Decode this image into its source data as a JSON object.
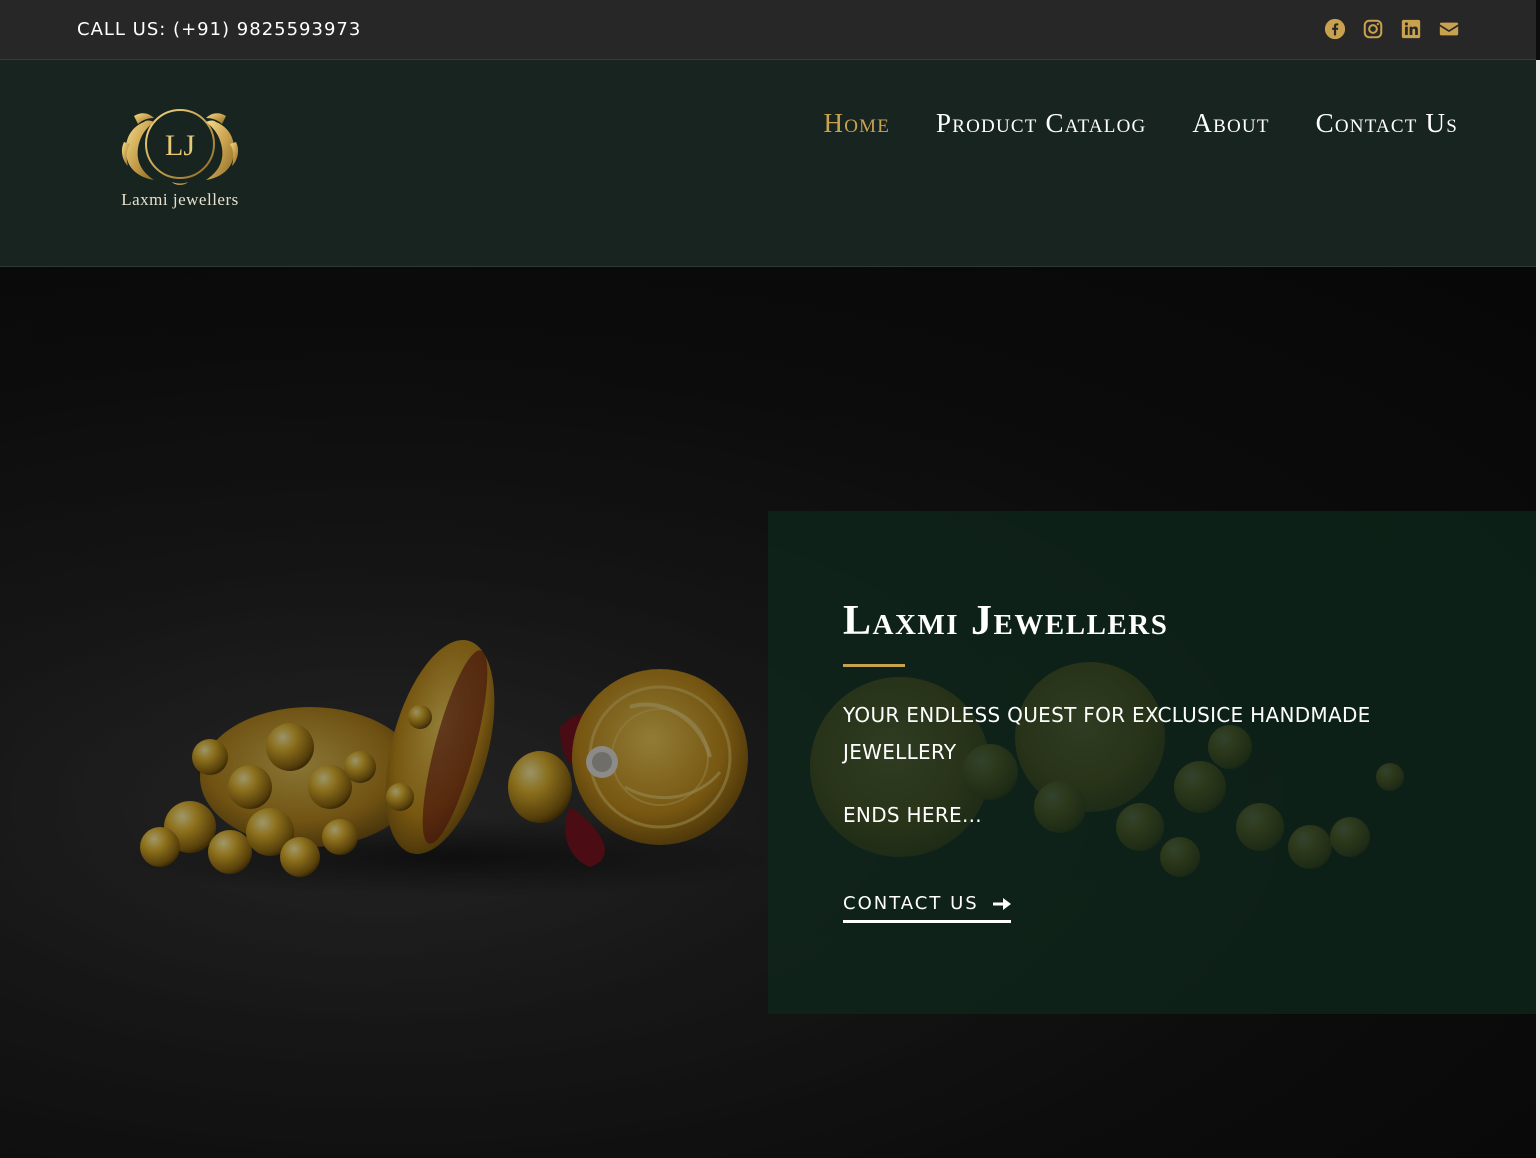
{
  "topbar": {
    "call_text": "CALL US: (+91) 9825593973",
    "social": [
      {
        "icon": "facebook-icon"
      },
      {
        "icon": "instagram-icon"
      },
      {
        "icon": "linkedin-icon"
      },
      {
        "icon": "email-icon"
      }
    ],
    "icon_color": "#c9a24f"
  },
  "header": {
    "logo_monogram": "LJ",
    "logo_text": "Laxmi jewellers",
    "nav": [
      {
        "label": "Home",
        "active": true
      },
      {
        "label": "Product Catalog",
        "active": false
      },
      {
        "label": "About",
        "active": false
      },
      {
        "label": "Contact Us",
        "active": false
      }
    ],
    "accent_color": "#c9a24f",
    "background_color": "#172420"
  },
  "hero": {
    "title": "Laxmi Jewellers",
    "tagline": "YOUR ENDLESS QUEST FOR EXCLUSICE HANDMADE JEWELLERY",
    "ends": "ENDS HERE...",
    "cta_label": "CONTACT US",
    "cta_icon": "arrow-right-icon",
    "image": "gold-jhumka-earrings-photo"
  }
}
